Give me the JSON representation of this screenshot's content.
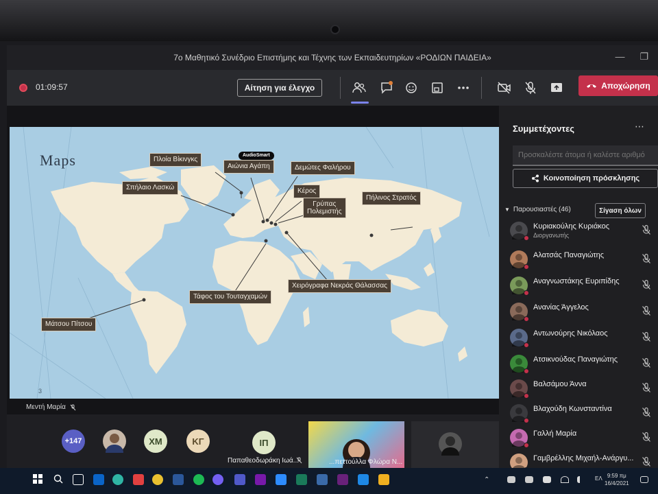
{
  "window": {
    "title": "7ο Μαθητικό Συνέδριο Επιστήμης και Τέχνης των Εκπαιδευτηρίων «ΡΟΔΙΩΝ ΠΑΙΔΕΙΑ»"
  },
  "toolbar": {
    "timer": "01:09:57",
    "request_control_label": "Αίτηση για έλεγχο",
    "leave_label": "Αποχώρηση",
    "icons": [
      "people-icon",
      "chat-icon",
      "reactions-icon",
      "rooms-icon",
      "more-icon",
      "camera-off-icon",
      "mic-off-icon",
      "share-tray-icon",
      "phone-icon"
    ]
  },
  "slide": {
    "badge": "AudioSmart",
    "title": "Maps",
    "page_number": "3",
    "labels": {
      "vikings": "Πλοία Βίκινγκς",
      "agathi": "Αιώνια Αγάπη",
      "falirou": "Δεμώτες Φαλήρου",
      "lascaux": "Σπήλαιο Λασκώ",
      "keros": "Κέρος",
      "grypas1": "Γρύπας",
      "grypas2": "Πολεμιστής",
      "army": "Πήλινος Στρατός",
      "machu": "Μάτσου Πίτσου",
      "tomb": "Τάφος του Τουταγχαμών",
      "scrolls": "Χειρόγραφα Νεκράς Θάλασσας"
    }
  },
  "presenter": {
    "name": "Μεντή Μαρία"
  },
  "strip": {
    "overflow_count": "+147",
    "initials": [
      "ΧΜ",
      "ΚΓ",
      "ΙΠ"
    ],
    "names": {
      "ip": "Παπαθεοδωράκη Ιωά...",
      "video": "...πεττούλλα Φλώρα Ν..."
    }
  },
  "panel": {
    "title": "Συμμετέχοντες",
    "invite_placeholder": "Προσκαλέστε άτομα ή καλέστε αριθμό",
    "share_label": "Κοινοποίηση πρόσκλησης",
    "presenters_label": "Παρουσιαστές (46)",
    "mute_all_label": "Σίγαση όλων",
    "participants": [
      {
        "name": "Κυριακούλης Κυριάκος",
        "role": "Διοργανωτής",
        "color": "#4a4a4e"
      },
      {
        "name": "Αλατσάς Παναγιώτης",
        "role": "",
        "color": "#b07a5a"
      },
      {
        "name": "Αναγνωστάκης Ευριπίδης",
        "role": "",
        "color": "#7a9a5a"
      },
      {
        "name": "Ανανίας Άγγελος",
        "role": "",
        "color": "#8a6a5a"
      },
      {
        "name": "Αντωνούρης Νικόλαος",
        "role": "",
        "color": "#5a6a8a"
      },
      {
        "name": "Ατσικνούδας Παναγιώτης",
        "role": "",
        "color": "#3a8a3a"
      },
      {
        "name": "Βαλσάμου Άννα",
        "role": "",
        "color": "#6a4a4a"
      },
      {
        "name": "Βλαχούδη Κωνσταντίνα",
        "role": "",
        "color": "#3a3a3e"
      },
      {
        "name": "Γαλλή Μαρία",
        "role": "",
        "color": "#c46ab0"
      },
      {
        "name": "Γαμβρέλλης Μιχαήλ-Ανάργυ...",
        "role": "",
        "color": "#d0a080"
      }
    ]
  },
  "taskbar": {
    "lang": "ΕΛ",
    "time": "9:59 πμ",
    "date": "16/4/2021"
  },
  "colors": {
    "accent": "#7b83eb",
    "leave": "#c4314b",
    "slide_bg": "#a9cde3",
    "land": "#f4ebd6"
  }
}
